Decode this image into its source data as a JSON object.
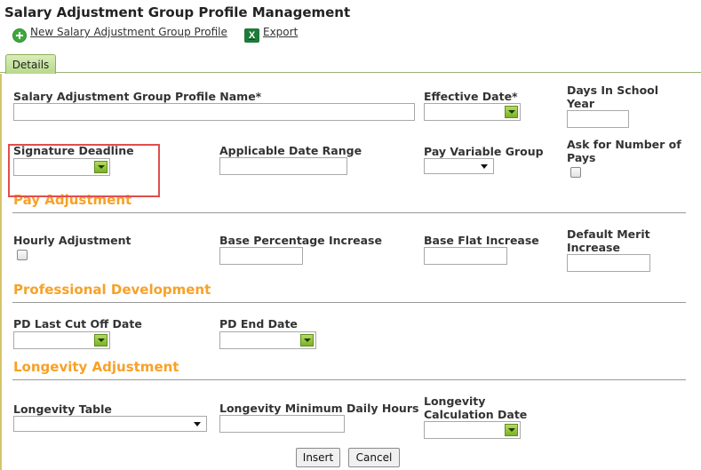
{
  "page": {
    "title": "Salary Adjustment Group Profile Management"
  },
  "toolbar": {
    "new_label": "New Salary Adjustment Group Profile",
    "export_label": "Export",
    "excel_glyph": "X"
  },
  "tabs": [
    {
      "label": "Details",
      "active": true
    }
  ],
  "form": {
    "profile_name": {
      "label": "Salary Adjustment Group Profile Name*",
      "value": ""
    },
    "effective_date": {
      "label": "Effective Date*",
      "value": ""
    },
    "days_in_school_year": {
      "label": "Days In School Year",
      "value": ""
    },
    "signature_deadline": {
      "label": "Signature Deadline",
      "value": ""
    },
    "applicable_date_range": {
      "label": "Applicable Date Range",
      "value": ""
    },
    "pay_variable_group": {
      "label": "Pay Variable Group",
      "selected": ""
    },
    "ask_number_of_pays": {
      "label": "Ask for Number of Pays",
      "checked": false
    }
  },
  "sections": {
    "pay_adjustment": "Pay Adjustment",
    "professional_development": "Professional Development",
    "longevity_adjustment": "Longevity Adjustment"
  },
  "pay_adjustment": {
    "hourly_adjustment": {
      "label": "Hourly Adjustment",
      "checked": false
    },
    "base_percentage_increase": {
      "label": "Base Percentage Increase",
      "value": ""
    },
    "base_flat_increase": {
      "label": "Base Flat Increase",
      "value": ""
    },
    "default_merit_increase": {
      "label": "Default Merit Increase",
      "value": ""
    }
  },
  "professional_development": {
    "pd_last_cut_off_date": {
      "label": "PD Last Cut Off Date",
      "value": ""
    },
    "pd_end_date": {
      "label": "PD End Date",
      "value": ""
    }
  },
  "longevity": {
    "longevity_table": {
      "label": "Longevity Table",
      "selected": ""
    },
    "minimum_daily_hours": {
      "label": "Longevity Minimum Daily Hours",
      "value": ""
    },
    "calculation_date": {
      "label": "Longevity Calculation Date",
      "value": ""
    }
  },
  "actions": {
    "insert_label": "Insert",
    "cancel_label": "Cancel"
  },
  "colors": {
    "section_heading": "#f7a128",
    "highlight_border": "#e14d4d",
    "tab_background": "#c6e39d",
    "calendar_button": "#8cc43a"
  }
}
